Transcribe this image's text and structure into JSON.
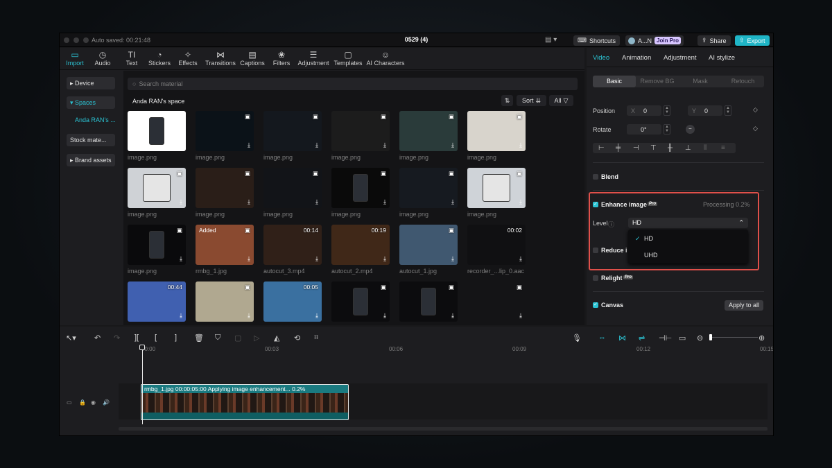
{
  "titlebar": {
    "auto_saved": "Auto saved: 00:21:48",
    "title": "0529 (4)",
    "shortcuts": "Shortcuts",
    "user": "A...N",
    "join_pro": "Join Pro",
    "share": "Share",
    "export": "Export"
  },
  "toolbar": {
    "tabs": [
      {
        "label": "Import",
        "icon": "▭"
      },
      {
        "label": "Audio",
        "icon": "◷"
      },
      {
        "label": "Text",
        "icon": "TI"
      },
      {
        "label": "Stickers",
        "icon": "◔"
      },
      {
        "label": "Effects",
        "icon": "✧"
      },
      {
        "label": "Transitions",
        "icon": "⋈"
      },
      {
        "label": "Captions",
        "icon": "▤"
      },
      {
        "label": "Filters",
        "icon": "❀"
      },
      {
        "label": "Adjustment",
        "icon": "☰"
      },
      {
        "label": "Templates",
        "icon": "▢"
      },
      {
        "label": "AI Characters",
        "icon": "☺"
      }
    ]
  },
  "sidebar": {
    "device": "▸ Device",
    "spaces": "▾ Spaces",
    "space_sub": "Anda RAN's ...",
    "stock": "Stock mate...",
    "brand": "▸ Brand assets"
  },
  "media": {
    "search_placeholder": "Search material",
    "space_name": "Anda RAN's space",
    "sort_label": "Sort",
    "all_label": "All",
    "items": [
      {
        "label": "image.png",
        "badge": "",
        "added": ""
      },
      {
        "label": "image.png",
        "badge": "▣",
        "added": ""
      },
      {
        "label": "image.png",
        "badge": "▣",
        "added": ""
      },
      {
        "label": "image.png",
        "badge": "▣",
        "added": ""
      },
      {
        "label": "image.png",
        "badge": "▣",
        "added": ""
      },
      {
        "label": "image.png",
        "badge": "▣",
        "added": ""
      },
      {
        "label": "image.png",
        "badge": "▣",
        "added": ""
      },
      {
        "label": "image.png",
        "badge": "▣",
        "added": ""
      },
      {
        "label": "image.png",
        "badge": "▣",
        "added": ""
      },
      {
        "label": "image.png",
        "badge": "▣",
        "added": ""
      },
      {
        "label": "image.png",
        "badge": "▣",
        "added": ""
      },
      {
        "label": "image.png",
        "badge": "▣",
        "added": ""
      },
      {
        "label": "image.png",
        "badge": "▣",
        "added": ""
      },
      {
        "label": "rmbg_1.jpg",
        "badge": "▣",
        "added": "Added"
      },
      {
        "label": "autocut_3.mp4",
        "badge": "00:14",
        "added": ""
      },
      {
        "label": "autocut_2.mp4",
        "badge": "00:19",
        "added": ""
      },
      {
        "label": "autocut_1.jpg",
        "badge": "▣",
        "added": ""
      },
      {
        "label": "recorder_...lip_0.aac",
        "badge": "00:02",
        "added": ""
      },
      {
        "label": "",
        "badge": "00:44",
        "added": ""
      },
      {
        "label": "",
        "badge": "▣",
        "added": ""
      },
      {
        "label": "",
        "badge": "00:05",
        "added": ""
      },
      {
        "label": "",
        "badge": "▣",
        "added": ""
      },
      {
        "label": "",
        "badge": "▣",
        "added": ""
      },
      {
        "label": "",
        "badge": "▣",
        "added": ""
      }
    ]
  },
  "panel": {
    "tabs": [
      "Video",
      "Animation",
      "Adjustment",
      "AI stylize"
    ],
    "subtabs": [
      "Basic",
      "Remove BG",
      "Mask",
      "Retouch"
    ],
    "position_label": "Position",
    "pos_x_label": "X",
    "pos_x": "0",
    "pos_y_label": "Y",
    "pos_y": "0",
    "rotate_label": "Rotate",
    "rotate": "0°",
    "blend_label": "Blend",
    "enhance_label": "Enhance image",
    "processing": "Processing 0.2%",
    "level_label": "Level",
    "level_value": "HD",
    "level_options": [
      "HD",
      "UHD"
    ],
    "reduce_label": "Reduce i",
    "relight_label": "Relight",
    "canvas_label": "Canvas",
    "apply_all": "Apply to all",
    "pro_badge": "Pro"
  },
  "timeline": {
    "ticks": [
      "00:00",
      "00:03",
      "00:06",
      "00:09",
      "00:12",
      "00:15"
    ],
    "clip_text": "rmbg_1.jpg  00:00:05:00  Applying image enhancement... 0.2%"
  },
  "colors": {
    "accent": "#2bc3d3",
    "highlight": "#e0504a"
  }
}
